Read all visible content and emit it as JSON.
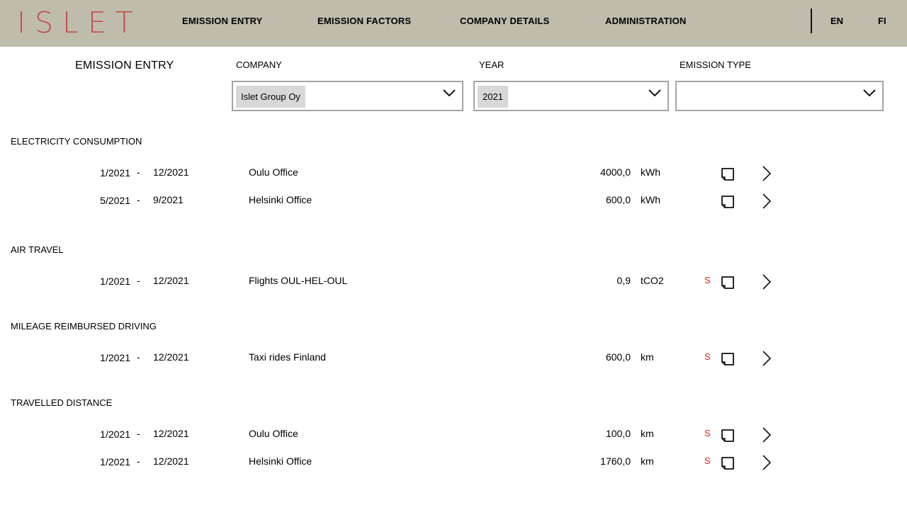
{
  "app": {
    "logo": "ISLET"
  },
  "nav": [
    {
      "label": "EMISSION ENTRY"
    },
    {
      "label": "EMISSION FACTORS"
    },
    {
      "label": "COMPANY DETAILS"
    },
    {
      "label": "ADMINISTRATION"
    }
  ],
  "languages": [
    {
      "label": "EN"
    },
    {
      "label": "FI"
    }
  ],
  "page": {
    "title": "EMISSION ENTRY"
  },
  "filters": {
    "company": {
      "label": "COMPANY",
      "value": "Islet Group Oy"
    },
    "year": {
      "label": "YEAR",
      "value": "2021"
    },
    "emission_type": {
      "label": "EMISSION TYPE",
      "value": ""
    }
  },
  "sections": [
    {
      "title": "ELECTRICITY CONSUMPTION",
      "rows": [
        {
          "start": "1/2021",
          "sep": "-",
          "end": "12/2021",
          "name": "Oulu Office",
          "amount": "4000,0",
          "unit": "kWh",
          "flag": ""
        },
        {
          "start": "5/2021",
          "sep": "-",
          "end": "9/2021",
          "name": "Helsinki Office",
          "amount": "600,0",
          "unit": "kWh",
          "flag": ""
        }
      ]
    },
    {
      "title": "AIR TRAVEL",
      "rows": [
        {
          "start": "1/2021",
          "sep": "-",
          "end": "12/2021",
          "name": "Flights OUL-HEL-OUL",
          "amount": "0,9",
          "unit": "tCO2",
          "flag": "S"
        }
      ]
    },
    {
      "title": "MILEAGE REIMBURSED DRIVING",
      "rows": [
        {
          "start": "1/2021",
          "sep": "-",
          "end": "12/2021",
          "name": "Taxi rides Finland",
          "amount": "600,0",
          "unit": "km",
          "flag": "S"
        }
      ]
    },
    {
      "title": "TRAVELLED DISTANCE",
      "rows": [
        {
          "start": "1/2021",
          "sep": "-",
          "end": "12/2021",
          "name": "Oulu Office",
          "amount": "100,0",
          "unit": "km",
          "flag": "S"
        },
        {
          "start": "1/2021",
          "sep": "-",
          "end": "12/2021",
          "name": "Helsinki Office",
          "amount": "1760,0",
          "unit": "km",
          "flag": "S"
        }
      ]
    }
  ],
  "icons": {
    "note": "note-icon",
    "open": "chevron-right-icon",
    "dropdown": "chevron-down-icon"
  },
  "colors": {
    "topbar": "#bfbcae",
    "logo": "#c0504d",
    "flag": "#e02020"
  }
}
